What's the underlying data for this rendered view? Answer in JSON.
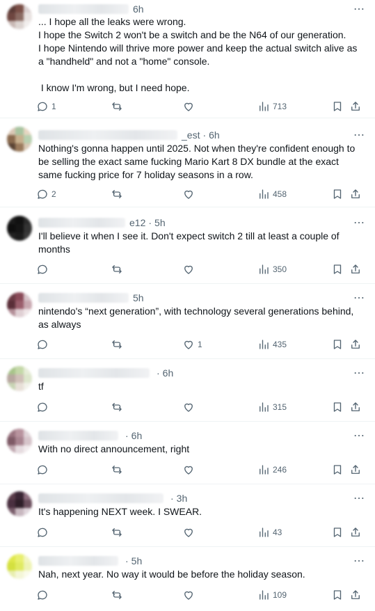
{
  "replies": [
    {
      "handle_fragment": "",
      "time": "6h",
      "text": "... I hope all the leaks were wrong.\nI hope the Switch 2 won't be a switch and be the N64 of our generation.\nI hope Nintendo will thrive more power and keep the actual switch alive as a \"handheld\" and not a \"home\" console.\n\n I know I'm wrong, but I need hope.",
      "reply_count": "1",
      "retweet_count": "",
      "like_count": "",
      "views": "713",
      "avatar_colors": [
        "#5a3a36",
        "#7a4e46",
        "#d8cfcf",
        "#6e4640",
        "#8a6a62",
        "#e8e2e0",
        "#c8b8b4",
        "#ddd5d2",
        "#f1eeed"
      ]
    },
    {
      "handle_fragment": "_est",
      "time": "6h",
      "text": "Nothing's gonna happen until 2025. Not when they're confident enough to be selling the exact same fucking Mario Kart 8 DX bundle at the exact same fucking price for 7 holiday seasons in a row.",
      "reply_count": "2",
      "retweet_count": "",
      "like_count": "",
      "views": "458",
      "avatar_colors": [
        "#d9c7b5",
        "#a8c4a0",
        "#e6d6c2",
        "#8a6a4e",
        "#c7b08e",
        "#b8d0b0",
        "#5a4434",
        "#9a7a5c",
        "#d8c8b4"
      ]
    },
    {
      "handle_fragment": "e12",
      "time": "5h",
      "text": "I'll believe it when I see it. Don't expect switch 2 till at least a couple of months",
      "reply_count": "",
      "retweet_count": "",
      "like_count": "",
      "views": "350",
      "avatar_colors": [
        "#1a1a1a",
        "#111111",
        "#2a2a2a",
        "#0e0e0e",
        "#151515",
        "#333333",
        "#222222",
        "#1c1c1c",
        "#3a3a3a"
      ]
    },
    {
      "handle_fragment": "",
      "time": "5h",
      "text": "nintendo's “next generation”, with technology several generations behind, as always",
      "reply_count": "",
      "retweet_count": "",
      "like_count": "1",
      "views": "435",
      "avatar_colors": [
        "#6b3a44",
        "#8a4a58",
        "#d6c3c8",
        "#5a2e38",
        "#9a5e6c",
        "#c8a8b0",
        "#b38f98",
        "#e0d0d4",
        "#f0e6e8"
      ]
    },
    {
      "handle_fragment": "",
      "time": "6h",
      "text": "tf",
      "reply_count": "",
      "retweet_count": "",
      "like_count": "",
      "views": "315",
      "avatar_colors": [
        "#a8c48a",
        "#c4d8a8",
        "#e6ecd8",
        "#b8a8a0",
        "#d0c0b8",
        "#dde6cc",
        "#c8d4b4",
        "#e8e0d8",
        "#f2f2ea"
      ]
    },
    {
      "handle_fragment": "",
      "time": "6h",
      "text": "With no direct announcement, right",
      "reply_count": "",
      "retweet_count": "",
      "like_count": "",
      "views": "246",
      "avatar_colors": [
        "#9a7480",
        "#b8939e",
        "#e0d4d8",
        "#7e5a66",
        "#a88490",
        "#d6c4ca",
        "#c0a8b0",
        "#e6dce0",
        "#f2ecee"
      ]
    },
    {
      "handle_fragment": "",
      "time": "3h",
      "text": "It's happening NEXT week. I SWEAR.",
      "reply_count": "",
      "retweet_count": "",
      "like_count": "",
      "views": "43",
      "avatar_colors": [
        "#5a3c4a",
        "#3a2634",
        "#8e6e7e",
        "#4a3040",
        "#2e1e28",
        "#6a4e5c",
        "#7a5e6c",
        "#c8b8c0",
        "#e0d6dc"
      ]
    },
    {
      "handle_fragment": "",
      "time": "5h",
      "text": "Nah, next year. No way it would be before the holiday season.",
      "reply_count": "",
      "retweet_count": "",
      "like_count": "",
      "views": "109",
      "avatar_colors": [
        "#dfe84a",
        "#e8ef70",
        "#f2f5c0",
        "#d4e040",
        "#e0ea62",
        "#eef3b4",
        "#e8eeb0",
        "#f4f6d8",
        "#fafbea"
      ]
    }
  ]
}
